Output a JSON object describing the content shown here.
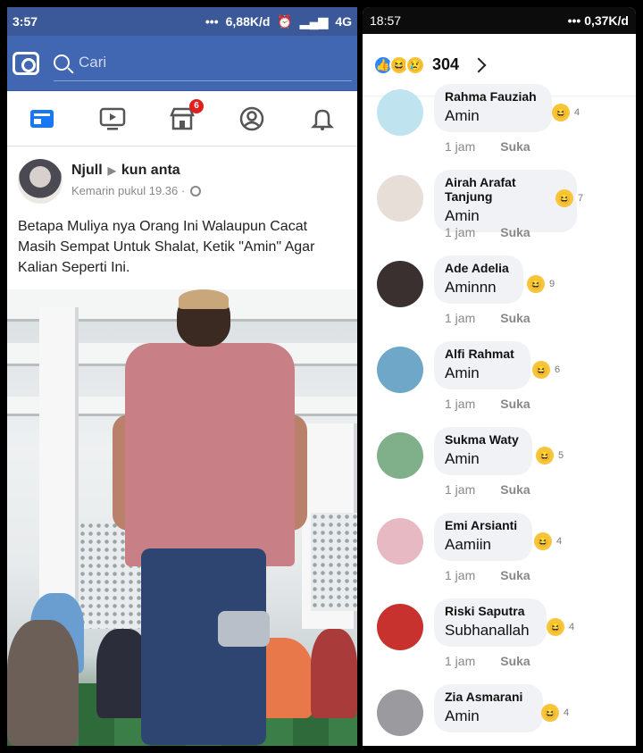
{
  "left": {
    "status": {
      "time": "3:57",
      "net": "6,88K/d",
      "signal": "4G"
    },
    "search_placeholder": "Cari",
    "nav": {
      "badge": "6"
    },
    "post": {
      "author": "Njull",
      "target": "kun anta",
      "meta": "Kemarin pukul 19.36 ·",
      "text": "Betapa Muliya nya Orang Ini Walaupun Cacat Masih Sempat Untuk Shalat, Ketik \"Amin\" Agar Kalian Seperti Ini."
    }
  },
  "right": {
    "status": {
      "time": "18:57",
      "net": "0,37K/d"
    },
    "reaction_count": "304",
    "action_time": "1 jam",
    "action_like": "Suka",
    "comments": [
      {
        "name": "Rahma Fauziah",
        "text": "Amin",
        "reacts": "4",
        "avatar": "#bfe4ef"
      },
      {
        "name": "Airah Arafat Tanjung",
        "text": "Amin",
        "reacts": "7",
        "avatar": "#e8ded8"
      },
      {
        "name": "Ade Adelia",
        "text": "Aminnn",
        "reacts": "9",
        "avatar": "#3a3030"
      },
      {
        "name": "Alfi Rahmat",
        "text": "Amin",
        "reacts": "6",
        "avatar": "#6fa7c9"
      },
      {
        "name": "Sukma Waty",
        "text": "Amin",
        "reacts": "5",
        "avatar": "#7fb08a"
      },
      {
        "name": "Emi Arsianti",
        "text": "Aamiin",
        "reacts": "4",
        "avatar": "#e7b9c2"
      },
      {
        "name": "Riski Saputra",
        "text": "Subhanallah",
        "reacts": "4",
        "avatar": "#c7322f"
      },
      {
        "name": "Zia Asmarani",
        "text": "Amin",
        "reacts": "4",
        "avatar": "#9a9a9f"
      }
    ]
  }
}
